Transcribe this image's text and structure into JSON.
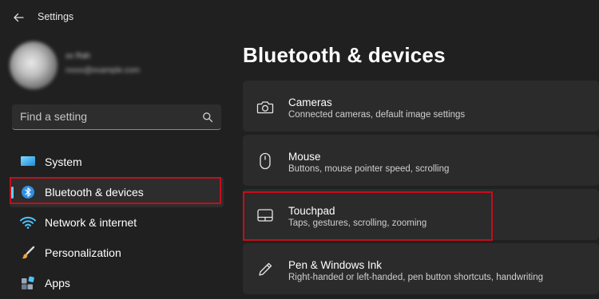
{
  "window": {
    "title": "Settings"
  },
  "profile": {
    "name": "xx Rah",
    "email": "rxxxx@example.com"
  },
  "search": {
    "placeholder": "Find a setting"
  },
  "sidebar": {
    "items": [
      {
        "label": "System",
        "icon": "system-icon",
        "selected": false
      },
      {
        "label": "Bluetooth & devices",
        "icon": "bluetooth-icon",
        "selected": true
      },
      {
        "label": "Network & internet",
        "icon": "network-icon",
        "selected": false
      },
      {
        "label": "Personalization",
        "icon": "personalization-icon",
        "selected": false
      },
      {
        "label": "Apps",
        "icon": "apps-icon",
        "selected": false
      }
    ]
  },
  "main": {
    "title": "Bluetooth & devices",
    "cards": [
      {
        "title": "Cameras",
        "subtitle": "Connected cameras, default image settings",
        "icon": "camera-icon"
      },
      {
        "title": "Mouse",
        "subtitle": "Buttons, mouse pointer speed, scrolling",
        "icon": "mouse-icon"
      },
      {
        "title": "Touchpad",
        "subtitle": "Taps, gestures, scrolling, zooming",
        "icon": "touchpad-icon"
      },
      {
        "title": "Pen & Windows Ink",
        "subtitle": "Right-handed or left-handed, pen button shortcuts, handwriting",
        "icon": "pen-icon"
      }
    ]
  },
  "colors": {
    "accent": "#60cdff",
    "highlight": "#c40e1c",
    "background": "#202020",
    "card": "#2b2b2b"
  }
}
